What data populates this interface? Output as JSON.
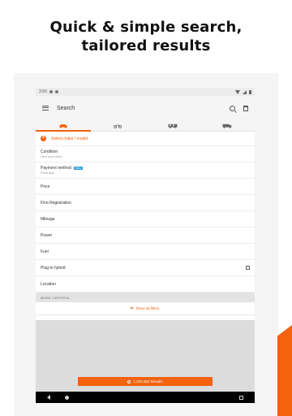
{
  "headline": {
    "line1": "Quick & simple search,",
    "line2": "tailored results"
  },
  "status_bar": {
    "time": "3:50"
  },
  "app_bar": {
    "title": "Search"
  },
  "tabs": [
    {
      "icon": "car-icon",
      "active": true
    },
    {
      "icon": "motorbike-icon",
      "active": false
    },
    {
      "icon": "motorhome-icon",
      "active": false
    },
    {
      "icon": "truck-icon",
      "active": false
    }
  ],
  "make_model": {
    "label": "Select make / model"
  },
  "filters": {
    "condition": {
      "label": "Condition",
      "value": "New and Used"
    },
    "payment": {
      "label": "Payment method",
      "badge": "New",
      "value": "Purchase"
    },
    "price": "Price",
    "first_registration": "First Registration",
    "mileage": "Mileage",
    "power": "Power",
    "fuel": "Fuel",
    "plug_in_hybrid": "Plug-in hybrid",
    "location": "Location"
  },
  "more_criteria": "MORE CRITERIA",
  "show_all": "Show all filters",
  "results_button": "1,203,353 Results",
  "colors": {
    "accent": "#f2620f",
    "badge": "#2a9ad8"
  }
}
